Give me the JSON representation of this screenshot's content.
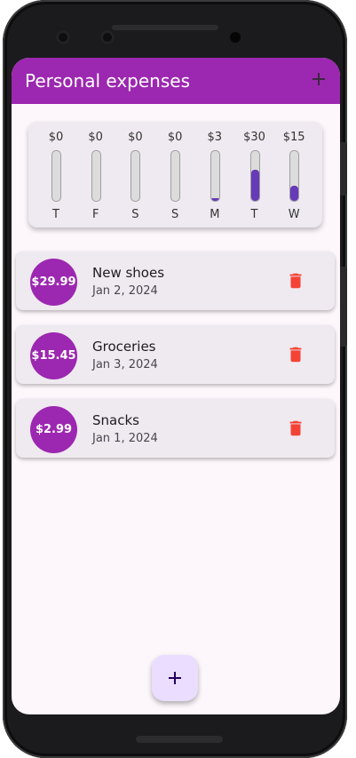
{
  "appbar": {
    "title": "Personal expenses",
    "add_icon": "plus-icon"
  },
  "chart_data": {
    "type": "bar",
    "categories": [
      "T",
      "F",
      "S",
      "S",
      "M",
      "T",
      "W"
    ],
    "amount_labels": [
      "$0",
      "$0",
      "$0",
      "$0",
      "$3",
      "$30",
      "$15"
    ],
    "fill_fractions": [
      0,
      0,
      0,
      0,
      0.06,
      0.62,
      0.31
    ]
  },
  "expenses": [
    {
      "amount": "$29.99",
      "title": "New shoes",
      "date": "Jan 2, 2024"
    },
    {
      "amount": "$15.45",
      "title": "Groceries",
      "date": "Jan 3, 2024"
    },
    {
      "amount": "$2.99",
      "title": "Snacks",
      "date": "Jan 1, 2024"
    }
  ],
  "colors": {
    "primary": "#9c27b0",
    "bar_fill": "#673ab7",
    "delete": "#f44336",
    "fab": "#eaddff"
  },
  "fab": {
    "icon": "plus-icon"
  }
}
